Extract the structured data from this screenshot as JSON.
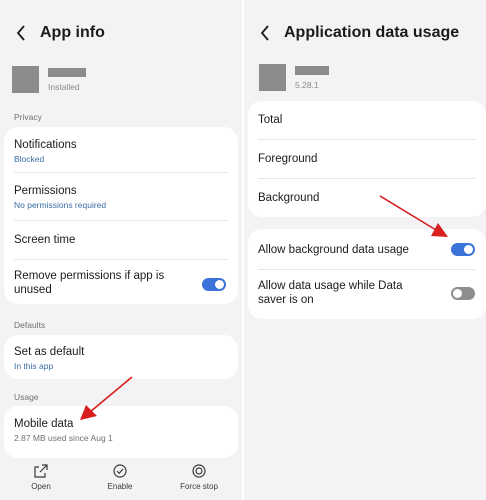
{
  "left": {
    "title": "App info",
    "app_sub": "Installed",
    "privacy_label": "Privacy",
    "notifications": {
      "title": "Notifications",
      "sub": "Blocked"
    },
    "permissions": {
      "title": "Permissions",
      "sub": "No permissions required"
    },
    "screen_time": {
      "title": "Screen time"
    },
    "remove_permissions": {
      "title_line1": "Remove permissions if app is",
      "title_line2": "unused",
      "enabled": true
    },
    "defaults_label": "Defaults",
    "set_default": {
      "title": "Set as default",
      "sub": "In this app"
    },
    "usage_label": "Usage",
    "mobile_data": {
      "title": "Mobile data",
      "sub": "2.87 MB used since Aug 1"
    },
    "bottom": {
      "open": "Open",
      "enable": "Enable",
      "force_stop": "Force stop"
    }
  },
  "right": {
    "title": "Application data usage",
    "app_version": "5.28.1",
    "total": "Total",
    "foreground": "Foreground",
    "background": "Background",
    "allow_background": {
      "title": "Allow background data usage",
      "enabled": true
    },
    "allow_saver": {
      "title_line1": "Allow data usage while Data",
      "title_line2": "saver is on",
      "enabled": false
    }
  },
  "colors": {
    "accent": "#3b73d9",
    "annotation_arrow": "#d81e1e",
    "link_text": "#3a6ea5"
  },
  "icons": [
    "back-arrow-icon",
    "open-icon",
    "enable-icon",
    "force-stop-icon"
  ]
}
